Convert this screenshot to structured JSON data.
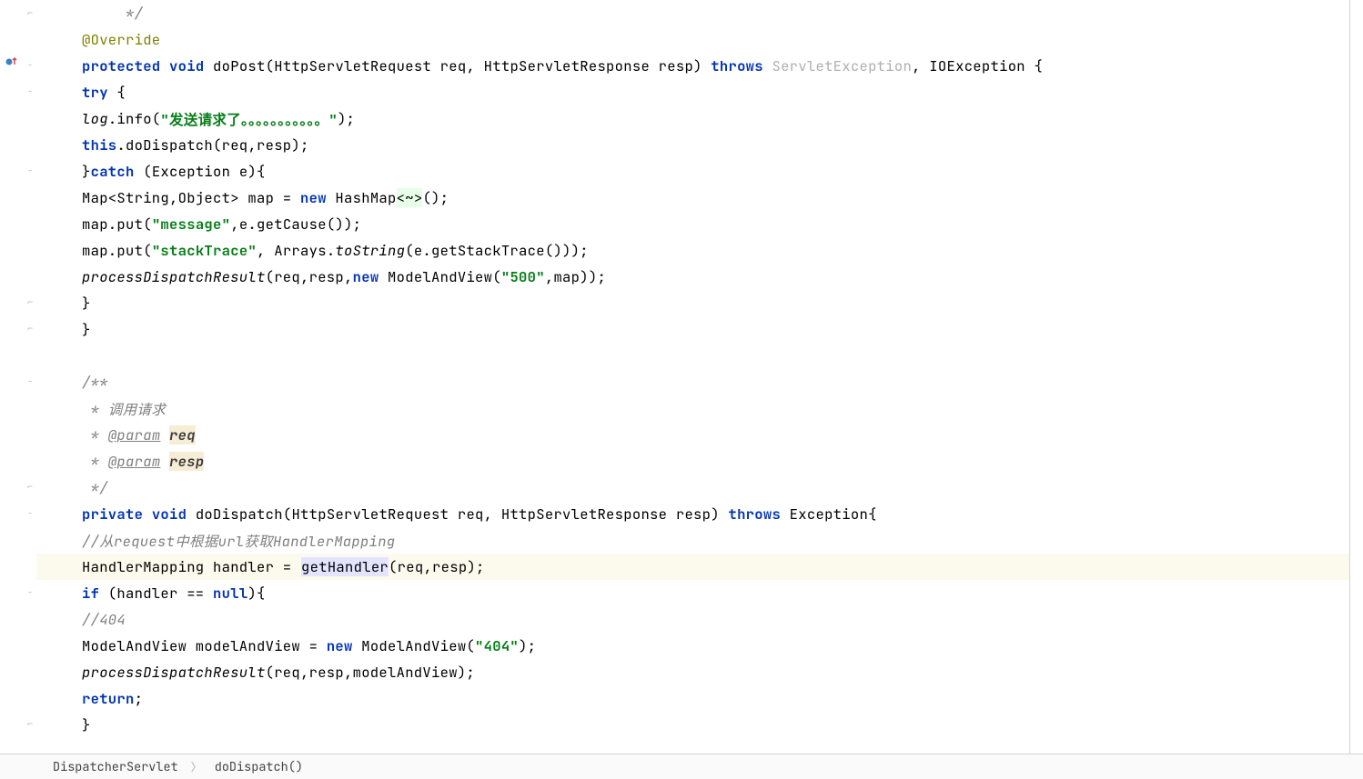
{
  "breadcrumb": {
    "file": "DispatcherServlet",
    "method": "doDispatch()"
  },
  "code": {
    "l1": "     */",
    "l2_annotation": "@Override",
    "l3_protected": "protected",
    "l3_void": "void",
    "l3_method": "doPost",
    "l3_params": "(HttpServletRequest req, HttpServletResponse resp)",
    "l3_throws": "throws",
    "l3_ex1": "ServletException",
    "l3_rest": ", IOException {",
    "l4_try": "try",
    "l4_brace": " {",
    "l5_log": "log",
    "l5_info": ".info(",
    "l5_str": "\"发送请求了。。。。。。。。。。。\"",
    "l5_end": ");",
    "l6_this": "this",
    "l6_rest": ".doDispatch(req,resp);",
    "l7_brace": "}",
    "l7_catch": "catch",
    "l7_rest": " (Exception e){",
    "l8_pre": "Map<String,Object> map = ",
    "l8_new": "new",
    "l8_hash": " HashMap",
    "l8_diamond": "<~>",
    "l8_end": "();",
    "l9_pre": "map.put(",
    "l9_str": "\"message\"",
    "l9_rest": ",e.getCause());",
    "l10_pre": "map.put(",
    "l10_str": "\"stackTrace\"",
    "l10_mid": ", Arrays.",
    "l10_tostr": "toString",
    "l10_rest": "(e.getStackTrace()));",
    "l11_pdr": "processDispatchResult",
    "l11_mid": "(req,resp,",
    "l11_new": "new",
    "l11_mav": " ModelAndView(",
    "l11_str": "\"500\"",
    "l11_rest": ",map));",
    "l12": "}",
    "l13": "}",
    "l15": "/**",
    "l16": " * 调用请求",
    "l17_pre": " * ",
    "l17_param": "@param",
    "l17_name": "req",
    "l18_pre": " * ",
    "l18_param": "@param",
    "l18_name": "resp",
    "l19": " */",
    "l20_private": "private",
    "l20_void": "void",
    "l20_method": "doDispatch",
    "l20_params": "(HttpServletRequest req, HttpServletResponse resp)",
    "l20_throws": "throws",
    "l20_rest": " Exception{",
    "l21": "//从request中根据url获取HandlerMapping",
    "l22_pre": "HandlerMapping handler = ",
    "l22_gethandler": "getHandler",
    "l22_rest": "(req,resp);",
    "l23_if": "if",
    "l23_pre": " (handler == ",
    "l23_null": "null",
    "l23_rest": "){",
    "l24": "//404",
    "l25_pre": "ModelAndView modelAndView = ",
    "l25_new": "new",
    "l25_mav": " ModelAndView(",
    "l25_str": "\"404\"",
    "l25_rest": ");",
    "l26_pdr": "processDispatchResult",
    "l26_rest": "(req,resp,modelAndView);",
    "l27_return": "return",
    "l27_semi": ";",
    "l28": "}"
  },
  "icons": {
    "override": "override-up-icon"
  }
}
